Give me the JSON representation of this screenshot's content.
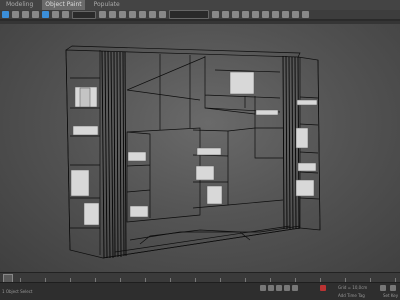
{
  "menubar": {
    "items": [
      {
        "label": "Modeling"
      },
      {
        "label": "Object Paint",
        "selected": true
      },
      {
        "label": "Populate"
      }
    ]
  },
  "status": {
    "left_text": "1 Object Select",
    "grid_text": "Grid = 10,0cm",
    "addtime_label": "Add Time Tag",
    "setkey_label": "Set Key"
  },
  "colors": {
    "viewport_center": "#6a6a6a",
    "wireframe": "#000000",
    "object": "#d8d8d8",
    "accent": "#3b8fd9"
  }
}
